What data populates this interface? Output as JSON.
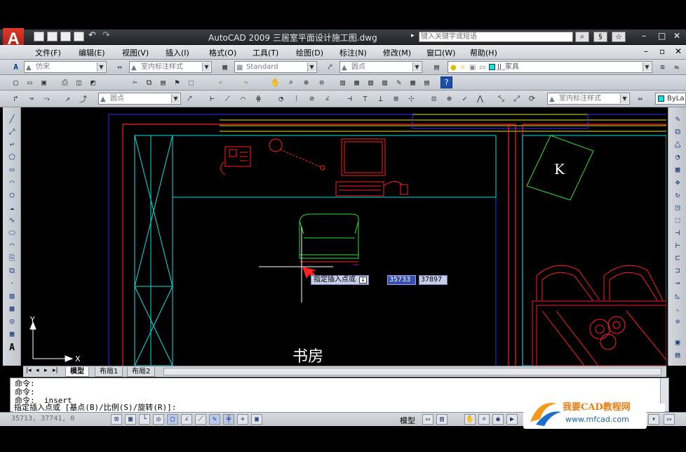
{
  "title": {
    "text": "AutoCAD 2009  三居室平面设计施工图.dwg",
    "search_placeholder": "键入关键字或短语"
  },
  "menu": [
    "文件(F)",
    "编辑(E)",
    "视图(V)",
    "插入(I)",
    "格式(O)",
    "工具(T)",
    "绘图(D)",
    "标注(N)",
    "修改(M)",
    "窗口(W)",
    "帮助(H)"
  ],
  "toolbar1": {
    "text_style": "仿宋",
    "dim_style": "室内标注样式",
    "table_style": "Standard",
    "multileader_style": "圆点",
    "layer": "JJ_家具"
  },
  "toolbar3": {
    "leader_style": "圆点",
    "dim_style": "室内标注样式",
    "color": "ByLa"
  },
  "drawing": {
    "room_label": "书房",
    "label_k": "K",
    "tooltip_prompt": "指定插入点或",
    "coord_x": "35733",
    "coord_y": "37897",
    "ucs_y": "Y",
    "ucs_x": "X"
  },
  "tabs": [
    "模型",
    "布局1",
    "布局2"
  ],
  "command": {
    "lines": [
      "命令:",
      "命令:",
      "命令: _insert"
    ],
    "prompt": "指定插入点或 [基点(B)/比例(S)/旋转(R)]:"
  },
  "status": {
    "coords": "35713, 37741, 0",
    "model": "模型"
  },
  "watermark": {
    "brand": "我要CAD教程网",
    "url": "www.mfcad.com"
  },
  "colors": {
    "red": "#ff2020",
    "cyan": "#00e5e5",
    "blue": "#3030ff",
    "yellow": "#e6e62a",
    "green": "#30e030",
    "white": "#ffffff"
  }
}
